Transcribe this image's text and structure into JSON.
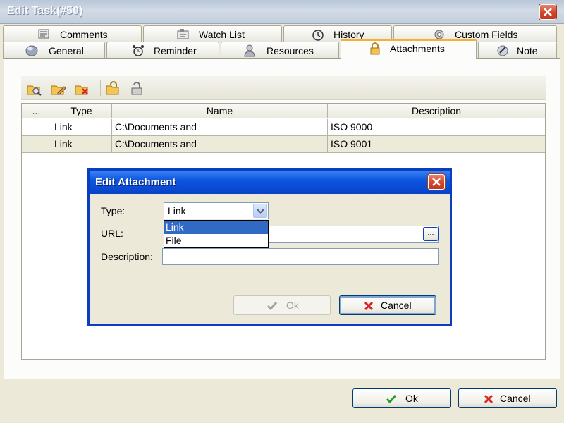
{
  "window": {
    "title": "Edit Task(#50)"
  },
  "tabs_top": [
    {
      "label": "Comments",
      "icon": "comments-icon"
    },
    {
      "label": "Watch List",
      "icon": "watch-list-icon"
    },
    {
      "label": "History",
      "icon": "history-icon"
    },
    {
      "label": "Custom Fields",
      "icon": "custom-fields-icon"
    }
  ],
  "tabs_bottom": [
    {
      "label": "General",
      "icon": "general-icon"
    },
    {
      "label": "Reminder",
      "icon": "alarm-clock-icon"
    },
    {
      "label": "Resources",
      "icon": "user-icon"
    },
    {
      "label": "Attachments",
      "icon": "lock-icon",
      "active": true
    },
    {
      "label": "Note",
      "icon": "note-icon"
    }
  ],
  "toolbar": {
    "buttons": [
      "view-attachment-icon",
      "edit-attachment-icon",
      "delete-attachment-icon",
      "open-folder-icon",
      "save-icon"
    ]
  },
  "grid": {
    "columns": [
      "...",
      "Type",
      "Name",
      "Description"
    ],
    "rows": [
      {
        "type": "Link",
        "name": "C:\\Documents and",
        "description": "ISO 9000"
      },
      {
        "type": "Link",
        "name": "C:\\Documents and",
        "description": "ISO 9001"
      }
    ]
  },
  "footer": {
    "ok_label": "Ok",
    "cancel_label": "Cancel"
  },
  "dialog": {
    "title": "Edit Attachment",
    "type_label": "Type:",
    "type_value": "Link",
    "type_options": [
      "Link",
      "File"
    ],
    "url_label": "URL:",
    "url_value": "",
    "browse_label": "...",
    "description_label": "Description:",
    "description_value": "",
    "ok_label": "Ok",
    "cancel_label": "Cancel"
  },
  "colors": {
    "dialog_title": "#0d57df",
    "active_tab_accent": "#f5b036",
    "selection": "#316ac5",
    "close_button": "#d2462a"
  }
}
